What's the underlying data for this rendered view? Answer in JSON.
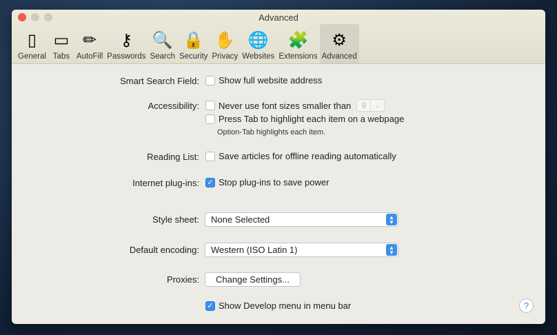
{
  "window": {
    "title": "Advanced"
  },
  "toolbar": {
    "tabs": [
      {
        "label": "General",
        "icon": "general-switch-icon",
        "glyph": "▯"
      },
      {
        "label": "Tabs",
        "icon": "tabs-icon",
        "glyph": "▭"
      },
      {
        "label": "AutoFill",
        "icon": "pencil-icon",
        "glyph": "✏"
      },
      {
        "label": "Passwords",
        "icon": "key-icon",
        "glyph": "⚷"
      },
      {
        "label": "Search",
        "icon": "magnifier-icon",
        "glyph": "🔍"
      },
      {
        "label": "Security",
        "icon": "lock-icon",
        "glyph": "🔒"
      },
      {
        "label": "Privacy",
        "icon": "hand-icon",
        "glyph": "✋"
      },
      {
        "label": "Websites",
        "icon": "globe-icon",
        "glyph": "🌐"
      },
      {
        "label": "Extensions",
        "icon": "puzzle-icon",
        "glyph": "🧩"
      },
      {
        "label": "Advanced",
        "icon": "gear-icon",
        "glyph": "⚙"
      }
    ],
    "selected": "Advanced"
  },
  "settings": {
    "smart_search": {
      "label": "Smart Search Field:",
      "option": "Show full website address",
      "checked": false
    },
    "accessibility": {
      "label": "Accessibility:",
      "font_option": "Never use font sizes smaller than",
      "font_size": "9",
      "tab_option": "Press Tab to highlight each item on a webpage",
      "hint": "Option-Tab highlights each item."
    },
    "reading_list": {
      "label": "Reading List:",
      "option": "Save articles for offline reading automatically"
    },
    "plugins": {
      "label": "Internet plug-ins:",
      "option": "Stop plug-ins to save power",
      "checked": true
    },
    "style_sheet": {
      "label": "Style sheet:",
      "value": "None Selected"
    },
    "encoding": {
      "label": "Default encoding:",
      "value": "Western (ISO Latin 1)"
    },
    "proxies": {
      "label": "Proxies:",
      "button": "Change Settings..."
    },
    "develop": {
      "option": "Show Develop menu in menu bar",
      "checked": true
    },
    "help": "?"
  },
  "colors": {
    "accent": "#3b8fe8",
    "close": "#ee5a52"
  }
}
